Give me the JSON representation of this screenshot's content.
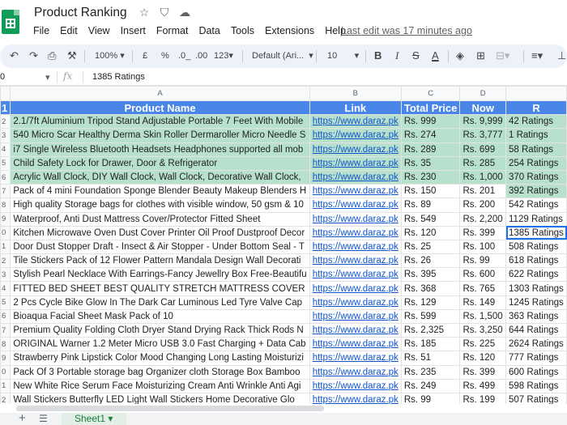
{
  "doc": {
    "title": "Product Ranking",
    "last_edit": "Last edit was 17 minutes ago",
    "star_icon": "star-icon",
    "drive_icon": "move-to-drive-icon",
    "cloud_icon": "cloud-saved-icon"
  },
  "menu": [
    "File",
    "Edit",
    "View",
    "Insert",
    "Format",
    "Data",
    "Tools",
    "Extensions",
    "Help"
  ],
  "toolbar": {
    "zoom": "100%",
    "currency": "£",
    "percent": "%",
    "dec_decrease": ".0_",
    "dec_increase": ".00",
    "number_format": "123",
    "font": "Default (Ari...",
    "font_size": "10",
    "bold": "B",
    "italic": "I",
    "strike": "S",
    "text_color": "A"
  },
  "formula": {
    "cell_ref": "0",
    "fx": "fx",
    "content": "1385 Ratings"
  },
  "columns": [
    "A",
    "B",
    "C",
    "D",
    "E"
  ],
  "header_row": {
    "num": "1",
    "cells": [
      "Product Name",
      "Link",
      "Total Price",
      "Now",
      "R"
    ]
  },
  "rows": [
    {
      "num": "2",
      "green": true,
      "cells": [
        "2.1/7ft Aluminium Tripod Stand Adjustable Portable 7 Feet With Mobile",
        "https://www.daraz.pk",
        "Rs. 999",
        "Rs. 9,999",
        "42 Ratings"
      ]
    },
    {
      "num": "3",
      "green": true,
      "cells": [
        "540 Micro Scar Healthy Derma Skin Roller Dermaroller Micro Needle S",
        "https://www.daraz.pk",
        "Rs. 274",
        "Rs. 3,777",
        "1 Ratings"
      ]
    },
    {
      "num": "4",
      "green": true,
      "cells": [
        "i7 Single Wireless Bluetooth Headsets Headphones supported all mob",
        "https://www.daraz.pk",
        "Rs. 289",
        "Rs. 699",
        "58 Ratings"
      ]
    },
    {
      "num": "5",
      "green": true,
      "cells": [
        "Child Safety Lock for Drawer, Door & Refrigerator",
        "https://www.daraz.pk",
        "Rs. 35",
        "Rs. 285",
        "254 Ratings"
      ]
    },
    {
      "num": "6",
      "green": true,
      "cells": [
        "Acrylic Wall Clock, DIY Wall Clock, Wall Clock, Decorative Wall Clock,",
        "https://www.daraz.pk",
        "Rs. 230",
        "Rs. 1,000",
        "370 Ratings"
      ]
    },
    {
      "num": "7",
      "green": false,
      "greenLast": true,
      "cells": [
        "Pack of 4 mini Foundation Sponge Blender Beauty Makeup Blenders H",
        "https://www.daraz.pk",
        "Rs. 150",
        "Rs. 201",
        "392 Ratings"
      ]
    },
    {
      "num": "8",
      "green": false,
      "cells": [
        "High quality Storage bags for clothes with visible window, 50 gsm & 10",
        "https://www.daraz.pk",
        "Rs. 89",
        "Rs. 200",
        "542 Ratings"
      ]
    },
    {
      "num": "9",
      "green": false,
      "cells": [
        "Waterproof, Anti Dust Mattress Cover/Protector Fitted Sheet",
        "https://www.daraz.pk",
        "Rs. 549",
        "Rs. 2,200",
        "1129 Ratings"
      ]
    },
    {
      "num": "0",
      "green": false,
      "selected": true,
      "cells": [
        "Kitchen Microwave Oven Dust Cover Printer Oil Proof Dustproof Decor",
        "https://www.daraz.pk",
        "Rs. 120",
        "Rs. 399",
        "1385 Ratings"
      ]
    },
    {
      "num": "1",
      "green": false,
      "cells": [
        "Door Dust Stopper Draft - Insect & Air Stopper - Under Bottom Seal - T",
        "https://www.daraz.pk",
        "Rs. 25",
        "Rs. 100",
        "508 Ratings"
      ]
    },
    {
      "num": "2",
      "green": false,
      "cells": [
        "Tile Stickers Pack of 12 Flower Pattern Mandala Design Wall Decorati",
        "https://www.daraz.pk",
        "Rs. 26",
        "Rs. 99",
        "618 Ratings"
      ]
    },
    {
      "num": "3",
      "green": false,
      "cells": [
        "Stylish Pearl Necklace With Earrings-Fancy Jewellry Box Free-Beautifu",
        "https://www.daraz.pk",
        "Rs. 395",
        "Rs. 600",
        "622 Ratings"
      ]
    },
    {
      "num": "4",
      "green": false,
      "cells": [
        "FITTED BED SHEET BEST QUALITY STRETCH MATTRESS COVER",
        "https://www.daraz.pk",
        "Rs. 368",
        "Rs. 765",
        "1303 Ratings"
      ]
    },
    {
      "num": "5",
      "green": false,
      "cells": [
        "2 Pcs Cycle Bike Glow In The Dark Car Luminous Led Tyre Valve Cap",
        "https://www.daraz.pk",
        "Rs. 129",
        "Rs. 149",
        "1245 Ratings"
      ]
    },
    {
      "num": "6",
      "green": false,
      "cells": [
        "Bioaqua Facial Sheet Mask Pack of 10",
        "https://www.daraz.pk",
        "Rs. 599",
        "Rs. 1,500",
        "363 Ratings"
      ]
    },
    {
      "num": "7",
      "green": false,
      "cells": [
        "Premium Quality Folding Cloth Dryer Stand Drying Rack Thick Rods N",
        "https://www.daraz.pk",
        "Rs. 2,325",
        "Rs. 3,250",
        "644 Ratings"
      ]
    },
    {
      "num": "8",
      "green": false,
      "cells": [
        "ORIGINAL Warner 1.2 Meter Micro USB 3.0 Fast Charging + Data Cab",
        "https://www.daraz.pk",
        "Rs. 185",
        "Rs. 225",
        "2624 Ratings"
      ]
    },
    {
      "num": "9",
      "green": false,
      "cells": [
        "Strawberry Pink Lipstick Color Mood Changing Long Lasting Moisturizi",
        "https://www.daraz.pk",
        "Rs. 51",
        "Rs. 120",
        "777 Ratings"
      ]
    },
    {
      "num": "0",
      "green": false,
      "cells": [
        "Pack Of 3 Portable storage bag Organizer cloth Storage Box Bamboo",
        "https://www.daraz.pk",
        "Rs. 235",
        "Rs. 399",
        "600 Ratings"
      ]
    },
    {
      "num": "1",
      "green": false,
      "cells": [
        "New White Rice Serum Face Moisturizing Cream Anti Wrinkle Anti Agi",
        "https://www.daraz.pk",
        "Rs. 249",
        "Rs. 499",
        "598 Ratings"
      ]
    },
    {
      "num": "2",
      "green": false,
      "cells": [
        "Wall Stickers Butterfly LED Light Wall Stickers Home Decorative Glo",
        "https://www.daraz.pk",
        "Rs. 99",
        "Rs. 199",
        "507 Ratings"
      ]
    }
  ],
  "sheets": {
    "add_icon": "plus-icon",
    "list_icon": "sheets-list-icon",
    "active_tab": "Sheet1"
  },
  "colors": {
    "header_blue": "#4a86e8",
    "row_green": "#b7e1cd",
    "link_blue": "#1155cc"
  }
}
